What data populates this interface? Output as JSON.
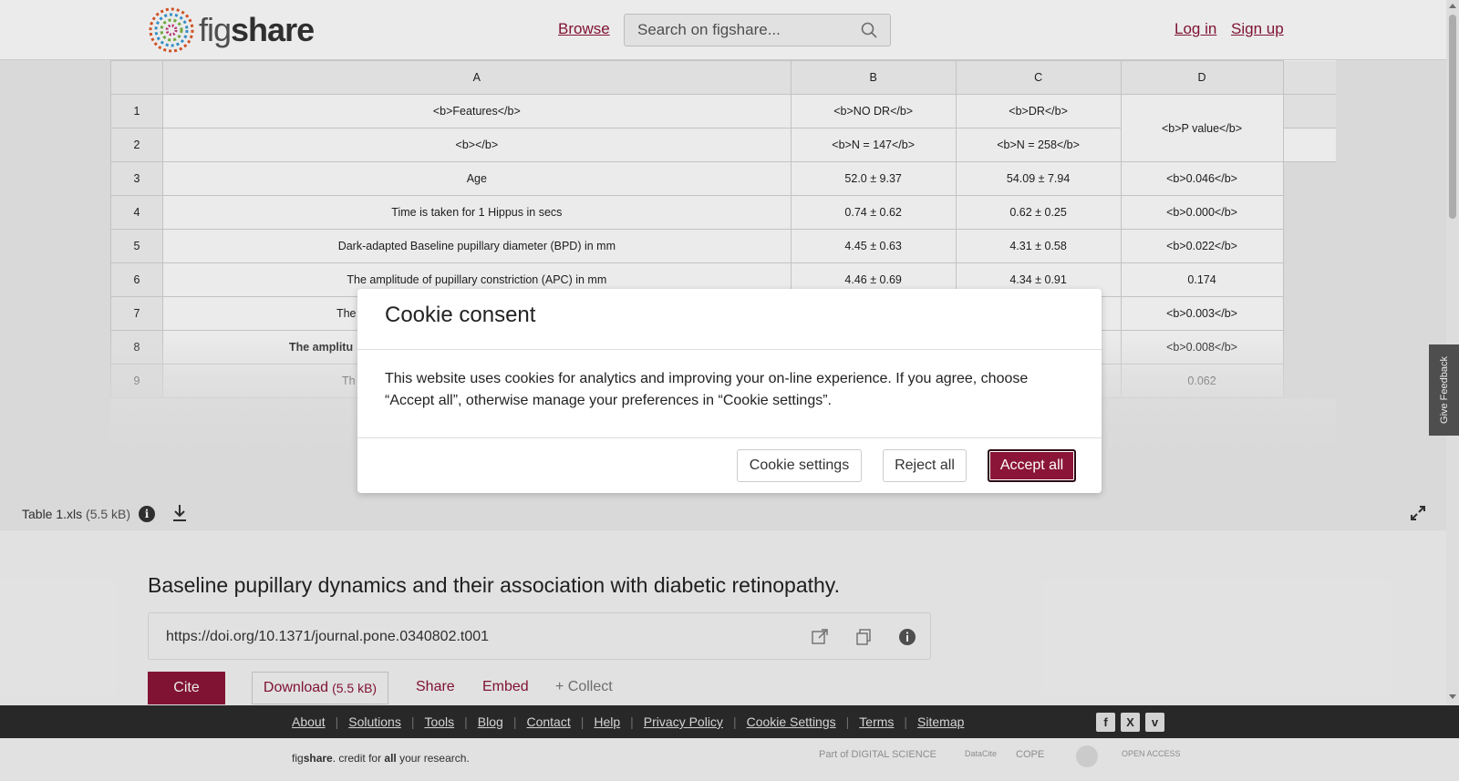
{
  "header": {
    "logo_prefix": "fig",
    "logo_suffix": "share",
    "browse_label": "Browse",
    "search_placeholder": "Search on figshare...",
    "login_label": "Log in",
    "signup_label": "Sign up"
  },
  "sheet": {
    "columns": [
      "",
      "A",
      "B",
      "C",
      "D"
    ],
    "rows": [
      {
        "n": "1",
        "a": "<b>Features</b>",
        "b": "<b>NO DR</b>",
        "c": "<b>DR</b>",
        "d": "<b>P value</b>"
      },
      {
        "n": "2",
        "a": "<b></b>",
        "b": "<b>N = 147</b>",
        "c": "<b>N = 258</b>",
        "d": ""
      },
      {
        "n": "3",
        "a": "Age",
        "b": "52.0 ± 9.37",
        "c": "54.09 ± 7.94",
        "d": "<b>0.046</b>"
      },
      {
        "n": "4",
        "a": "Time is taken for 1 Hippus in secs",
        "b": "0.74 ± 0.62",
        "c": "0.62 ± 0.25",
        "d": "<b>0.000</b>"
      },
      {
        "n": "5",
        "a": "Dark-adapted Baseline pupillary diameter (BPD) in mm",
        "b": "4.45 ± 0.63",
        "c": "4.31 ± 0.58",
        "d": "<b>0.022</b>"
      },
      {
        "n": "6",
        "a": "The amplitude of pupillary constriction (APC) in mm",
        "b": "4.46 ± 0.69",
        "c": "4.34 ± 0.91",
        "d": "0.174"
      },
      {
        "n": "7",
        "a": "The",
        "b": "",
        "c": "",
        "d": "<b>0.003</b>"
      },
      {
        "n": "8",
        "a": "The amplitu",
        "b": "",
        "c": "",
        "d": "<b>0.008</b>"
      },
      {
        "n": "9",
        "a": "Th",
        "b": "",
        "c": "",
        "d": "0.062"
      }
    ]
  },
  "file": {
    "name": "Table 1.xls",
    "size": "(5.5 kB)"
  },
  "item": {
    "title": "Baseline pupillary dynamics and their association with diabetic retinopathy.",
    "doi": "https://doi.org/10.1371/journal.pone.0340802.t001",
    "cite_label": "Cite",
    "download_label": "Download",
    "download_size": "(5.5 kB)",
    "share_label": "Share",
    "embed_label": "Embed",
    "collect_label": "+ Collect"
  },
  "footer": {
    "links": [
      "About",
      "Solutions",
      "Tools",
      "Blog",
      "Contact",
      "Help",
      "Privacy Policy",
      "Cookie Settings",
      "Terms",
      "Sitemap"
    ],
    "social": [
      "f",
      "X",
      "v"
    ],
    "tagline_pre": "fig",
    "tagline_bold": "share",
    "tagline_mid": ". credit for ",
    "tagline_all": "all",
    "tagline_post": " your research.",
    "partners": [
      "Part of DIGITAL SCIENCE",
      "DataCite",
      "COPE",
      "",
      "OPEN ACCESS"
    ]
  },
  "feedback_label": "Give Feedback",
  "cookie": {
    "title": "Cookie consent",
    "body": "This website uses cookies for analytics and improving your on-line experience. If you agree, choose “Accept all”, otherwise manage your preferences in “Cookie settings”.",
    "settings_label": "Cookie settings",
    "reject_label": "Reject all",
    "accept_label": "Accept all"
  },
  "colors": {
    "brand": "#8b1538",
    "footer_bg": "#2c2c2c"
  }
}
